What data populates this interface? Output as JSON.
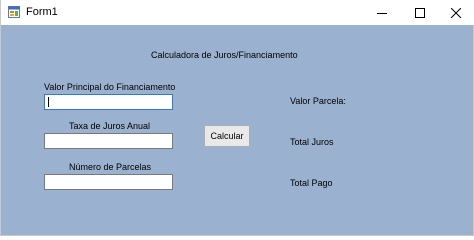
{
  "window": {
    "title": "Form1",
    "icon": "winforms-app-icon"
  },
  "controls": {
    "minimize": "minimize-icon",
    "maximize": "maximize-icon",
    "close": "close-icon"
  },
  "form": {
    "heading": "Calculadora de Juros/Financiamento",
    "principal_label": "Valor Principal do Financiamento",
    "principal_value": "",
    "rate_label": "Taxa de Juros Anual",
    "rate_value": "",
    "installments_label": "Número de Parcelas",
    "installments_value": "",
    "calculate_button": "Calcular",
    "result_installment": "Valor Parcela:",
    "result_total_interest": "Total Juros",
    "result_total_paid": "Total Pago"
  },
  "colors": {
    "form_background": "#9ab1cf",
    "titlebar": "#ffffff",
    "textbox_focus_border": "#3b77c7"
  }
}
